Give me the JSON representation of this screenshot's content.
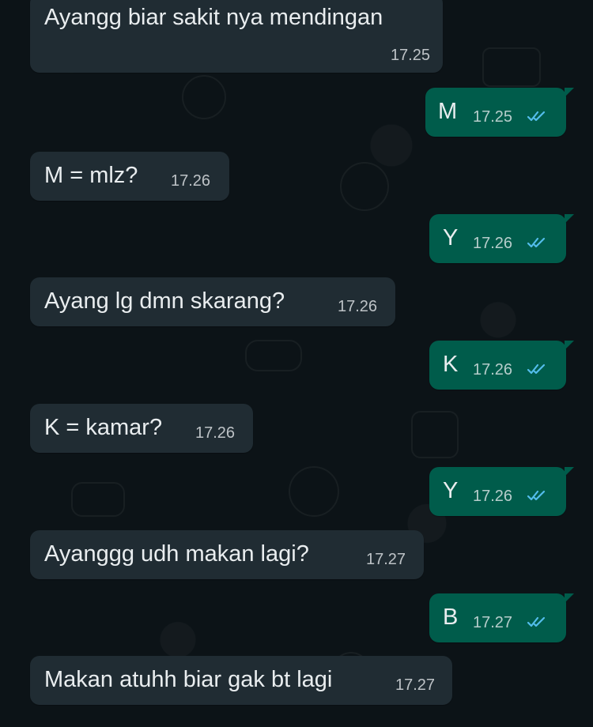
{
  "chat": {
    "messages": [
      {
        "direction": "incoming",
        "text": "Ayangg biar sakit nya mendingan",
        "time": "17.25"
      },
      {
        "direction": "outgoing",
        "text": "M",
        "time": "17.25",
        "status": "read"
      },
      {
        "direction": "incoming",
        "text": "M = mlz?",
        "time": "17.26"
      },
      {
        "direction": "outgoing",
        "text": "Y",
        "time": "17.26",
        "status": "read"
      },
      {
        "direction": "incoming",
        "text": "Ayang lg dmn skarang?",
        "time": "17.26"
      },
      {
        "direction": "outgoing",
        "text": "K",
        "time": "17.26",
        "status": "read"
      },
      {
        "direction": "incoming",
        "text": "K = kamar?",
        "time": "17.26"
      },
      {
        "direction": "outgoing",
        "text": "Y",
        "time": "17.26",
        "status": "read"
      },
      {
        "direction": "incoming",
        "text": "Ayanggg udh makan lagi?",
        "time": "17.27"
      },
      {
        "direction": "outgoing",
        "text": "B",
        "time": "17.27",
        "status": "read"
      },
      {
        "direction": "incoming",
        "text": "Makan atuhh biar gak bt lagi",
        "time": "17.27"
      }
    ]
  },
  "colors": {
    "background": "#0c1317",
    "incoming_bubble": "#202c33",
    "outgoing_bubble": "#005c4b",
    "text": "#e9edef",
    "read_ticks": "#53bdeb"
  },
  "icons": {
    "read_status": "double-check-icon"
  }
}
